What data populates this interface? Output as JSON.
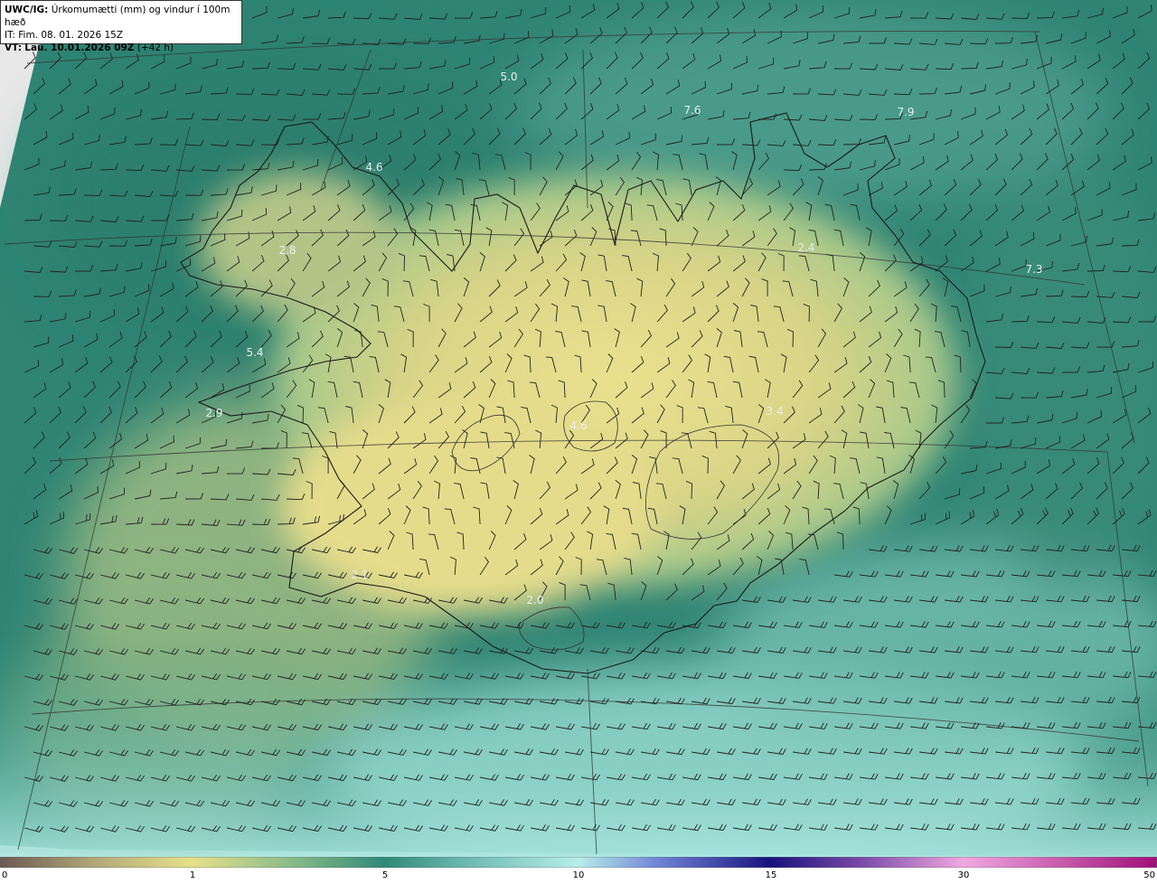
{
  "header": {
    "model": "UWC/IG:",
    "title": "Úrkomumætti (mm) og vindur í 100m hæð",
    "init_label": "IT:",
    "init_time": "Fim. 08. 01. 2026 15Z",
    "valid_label": "VT:",
    "valid_time": "Lau. 10.01.2026 09Z",
    "lead": "(+42 h)"
  },
  "colorbar": {
    "ticks": [
      {
        "label": "0",
        "value": 0
      },
      {
        "label": "1",
        "value": 1
      },
      {
        "label": "5",
        "value": 5
      },
      {
        "label": "10",
        "value": 10
      },
      {
        "label": "15",
        "value": 15
      },
      {
        "label": "30",
        "value": 30
      },
      {
        "label": "50",
        "value": 50
      }
    ],
    "colors": [
      {
        "value": 0,
        "color": "#6a5a52"
      },
      {
        "value": 0.5,
        "color": "#b5a879"
      },
      {
        "value": 1,
        "color": "#e6e089"
      },
      {
        "value": 3,
        "color": "#8cbc8a"
      },
      {
        "value": 5,
        "color": "#2f8a78"
      },
      {
        "value": 7,
        "color": "#6ab8ae"
      },
      {
        "value": 10,
        "color": "#b8eeea"
      },
      {
        "value": 12,
        "color": "#7287d8"
      },
      {
        "value": 15,
        "color": "#18127c"
      },
      {
        "value": 22,
        "color": "#7a4aa8"
      },
      {
        "value": 30,
        "color": "#f0a8e0"
      },
      {
        "value": 50,
        "color": "#a0107a"
      }
    ]
  },
  "map": {
    "coastline_color": "#1a1a1a",
    "barb_color": "#222222",
    "graticule_color": "#333333",
    "value_labels": [
      {
        "text": "5.0"
      },
      {
        "text": "7.6"
      },
      {
        "text": "7.9"
      },
      {
        "text": "4.6"
      },
      {
        "text": "2.8"
      },
      {
        "text": "2.4"
      },
      {
        "text": "7.3"
      },
      {
        "text": "5.4"
      },
      {
        "text": "2.9"
      },
      {
        "text": "4.6"
      },
      {
        "text": "3.4"
      },
      {
        "text": "2.1"
      },
      {
        "text": "2.0"
      }
    ]
  }
}
